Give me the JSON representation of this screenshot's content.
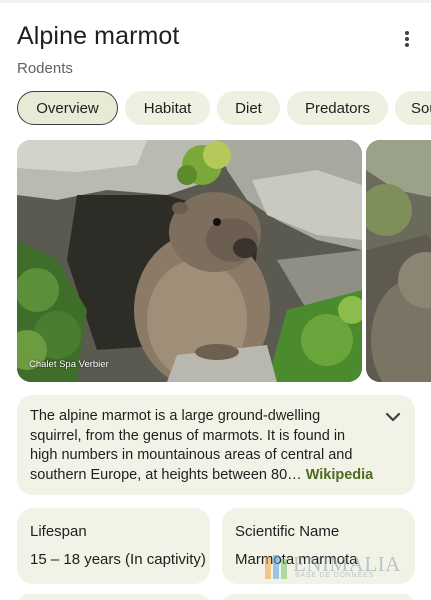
{
  "header": {
    "title": "Alpine marmot",
    "subtitle": "Rodents",
    "more_icon": "more-vert-icon"
  },
  "tabs": [
    {
      "label": "Overview",
      "active": true
    },
    {
      "label": "Habitat",
      "active": false
    },
    {
      "label": "Diet",
      "active": false
    },
    {
      "label": "Predators",
      "active": false
    },
    {
      "label": "Sou",
      "active": false
    }
  ],
  "gallery": {
    "photo_credit": "Chalet Spa Verbier"
  },
  "description": {
    "text": "The alpine marmot is a large ground-dwelling squirrel, from the genus of marmots. It is found in high numbers in mountainous areas of central and southern Europe, at heights between 80",
    "ellipsis": "… ",
    "source_link": "Wikipedia",
    "expand_icon": "chevron-down-icon"
  },
  "facts": [
    {
      "label": "Lifespan",
      "value": "15 – 18 years (In captivity)"
    },
    {
      "label": "Scientific Name",
      "value": "Marmota marmota"
    }
  ],
  "watermark": {
    "text": "ENIMALIA",
    "subtext": "BASE DE DONNÉES"
  },
  "colors": {
    "chip_bg": "#eef0e1",
    "card_bg": "#f2f3e6",
    "link": "#4c6b1f",
    "text": "#1f1f1f",
    "muted": "#5f6368"
  }
}
